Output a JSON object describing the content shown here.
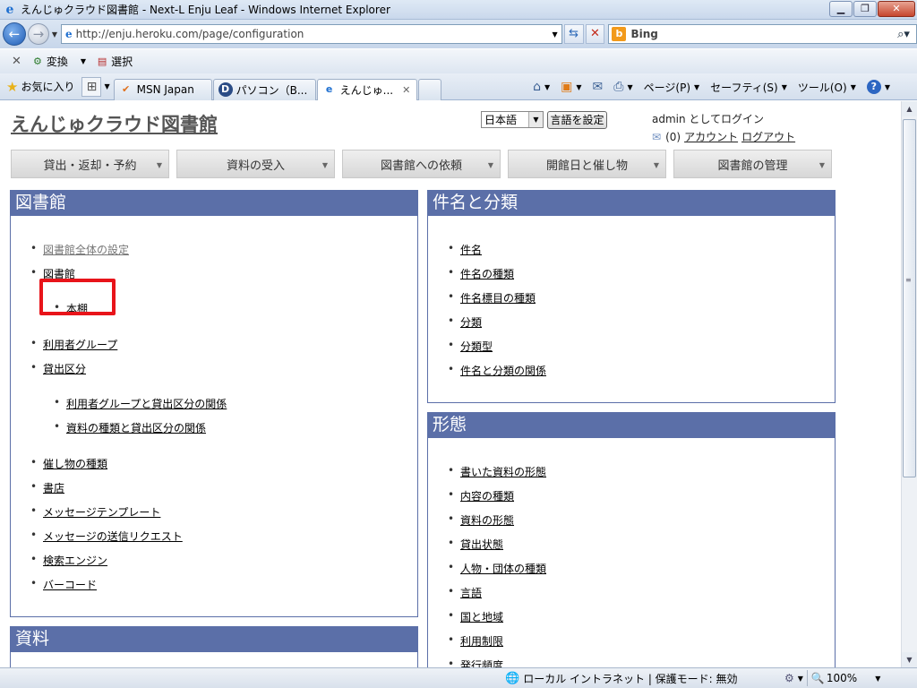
{
  "window": {
    "title": "えんじゅクラウド図書館 - Next-L Enju Leaf - Windows Internet Explorer",
    "minimize_icon": "minimize-icon",
    "restore_icon": "restore-icon",
    "close_icon": "close-icon"
  },
  "address": {
    "url": "http://enju.heroku.com/page/configuration",
    "search_placeholder": "Bing"
  },
  "commandbar": {
    "convert_label": "変換",
    "select_label": "選択"
  },
  "tabsbar": {
    "favorites_label": "お気に入り",
    "tabs": [
      {
        "label": "MSN Japan"
      },
      {
        "label": "パソコン（B..."
      },
      {
        "label": "えんじゅ..."
      }
    ],
    "page_label": "ページ(P)",
    "safety_label": "セーフティ(S)",
    "tools_label": "ツール(O)"
  },
  "site": {
    "title": "えんじゅクラウド図書館",
    "language_value": "日本語",
    "language_button": "言語を設定",
    "login_text": "admin としてログイン",
    "message_count": "(0)",
    "account_link": "アカウント",
    "logout_link": "ログアウト"
  },
  "menu": [
    {
      "label": "貸出・返却・予約"
    },
    {
      "label": "資料の受入"
    },
    {
      "label": "図書館への依頼"
    },
    {
      "label": "開館日と催し物"
    },
    {
      "label": "図書館の管理"
    }
  ],
  "panels": {
    "library": {
      "title": "図書館",
      "items": [
        "図書館全体の設定",
        "図書館",
        "本棚",
        "利用者グループ",
        "貸出区分",
        "利用者グループと貸出区分の関係",
        "資料の種類と貸出区分の関係",
        "催し物の種類",
        "書店",
        "メッセージテンプレート",
        "メッセージの送信リクエスト",
        "検索エンジン",
        "バーコード"
      ]
    },
    "subjects": {
      "title": "件名と分類",
      "items": [
        "件名",
        "件名の種類",
        "件名標目の種類",
        "分類",
        "分類型",
        "件名と分類の関係"
      ]
    },
    "forms": {
      "title": "形態",
      "items": [
        "書いた資料の形態",
        "内容の種類",
        "資料の形態",
        "貸出状態",
        "人物・団体の種類",
        "言語",
        "国と地域",
        "利用制限",
        "発行頻度"
      ]
    },
    "materials": {
      "title": "資料"
    }
  },
  "status": {
    "zone": "ローカル イントラネット | 保護モード: 無効",
    "zoom": "100%"
  }
}
